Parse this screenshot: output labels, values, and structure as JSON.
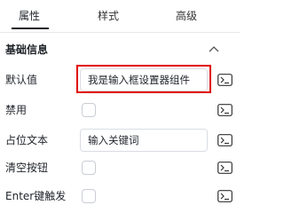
{
  "tabs": [
    {
      "label": "属性",
      "active": true
    },
    {
      "label": "样式",
      "active": false
    },
    {
      "label": "高级",
      "active": false
    }
  ],
  "section": {
    "title": "基础信息",
    "icon": "chevron-up-icon"
  },
  "rows": {
    "default_value": {
      "label": "默认值",
      "value": "我是输入框设置器组件"
    },
    "disabled": {
      "label": "禁用",
      "checked": false
    },
    "placeholder": {
      "label": "占位文本",
      "value": "输入关键词"
    },
    "clear_button": {
      "label": "清空按钮",
      "checked": false
    },
    "enter_trigger": {
      "label": "Enter键触发",
      "checked": false
    }
  },
  "icons": {
    "expression": "terminal-icon"
  },
  "colors": {
    "highlight": "#e00000",
    "border": "#d9dde3",
    "text": "#1f2329"
  }
}
